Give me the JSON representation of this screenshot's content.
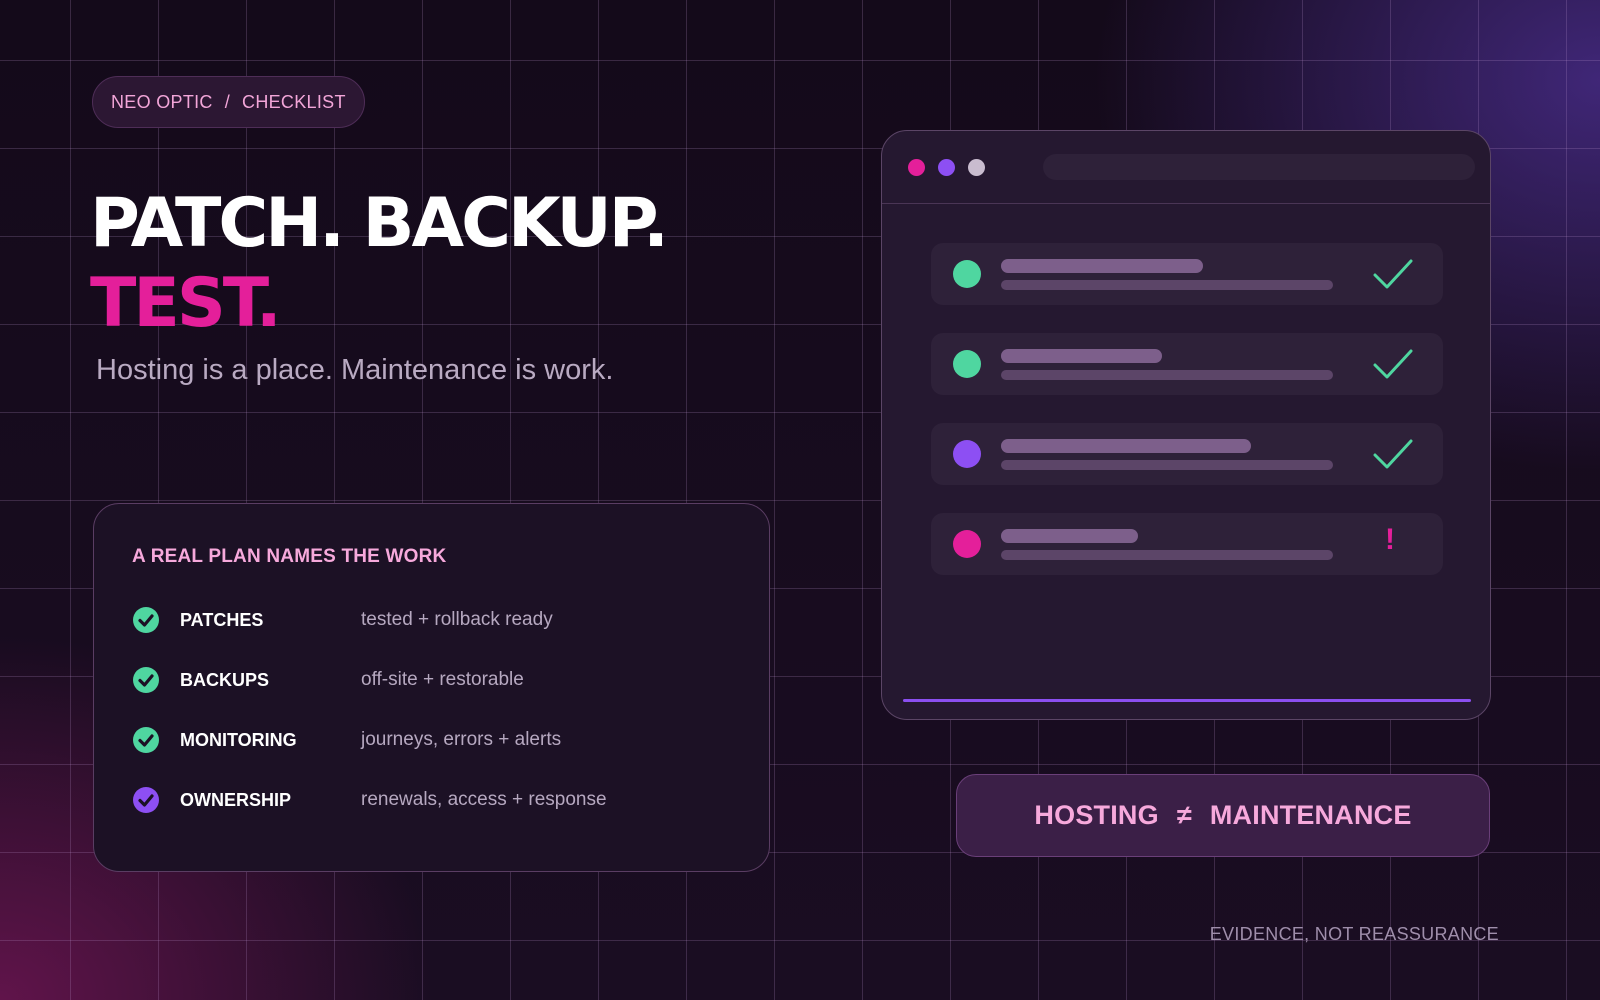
{
  "breadcrumb": {
    "brand": "NEO OPTIC",
    "separator": "/",
    "section": "CHECKLIST"
  },
  "headline": {
    "line1": "PATCH. BACKUP.",
    "line2": "TEST."
  },
  "subtitle": "Hosting is a place. Maintenance is work.",
  "plan": {
    "title": "A REAL PLAN NAMES THE WORK",
    "items": [
      {
        "name": "PATCHES",
        "detail": "tested + rollback ready",
        "icon": "check-circle-icon",
        "color": "#4fd6a0"
      },
      {
        "name": "BACKUPS",
        "detail": "off-site + restorable",
        "icon": "check-circle-icon",
        "color": "#4fd6a0"
      },
      {
        "name": "MONITORING",
        "detail": "journeys, errors + alerts",
        "icon": "check-circle-icon",
        "color": "#4fd6a0"
      },
      {
        "name": "OWNERSHIP",
        "detail": "renewals, access + response",
        "icon": "check-circle-icon",
        "color": "#8d4ff3"
      }
    ]
  },
  "browser_mock": {
    "window_dots": [
      "#e41f9a",
      "#8d4ff3",
      "#c9bccf"
    ],
    "tasks": [
      {
        "status_color": "#4fd6a0",
        "state": "done",
        "mark": "checkmark-icon",
        "label_length": 0.75
      },
      {
        "status_color": "#4fd6a0",
        "state": "done",
        "mark": "checkmark-icon",
        "label_length": 0.6
      },
      {
        "status_color": "#8d4ff3",
        "state": "done",
        "mark": "checkmark-icon",
        "label_length": 0.93
      },
      {
        "status_color": "#e41f9a",
        "state": "attention",
        "mark": "!",
        "label_length": 0.51
      }
    ]
  },
  "equation": {
    "left": "HOSTING",
    "operator": "≠",
    "right": "MAINTENANCE"
  },
  "footer": "EVIDENCE, NOT REASSURANCE",
  "colors": {
    "accent_pink": "#e41f9a",
    "accent_green": "#4fd6a0",
    "accent_purple": "#8d4ff3",
    "soft_pink": "#f7a9dc"
  }
}
